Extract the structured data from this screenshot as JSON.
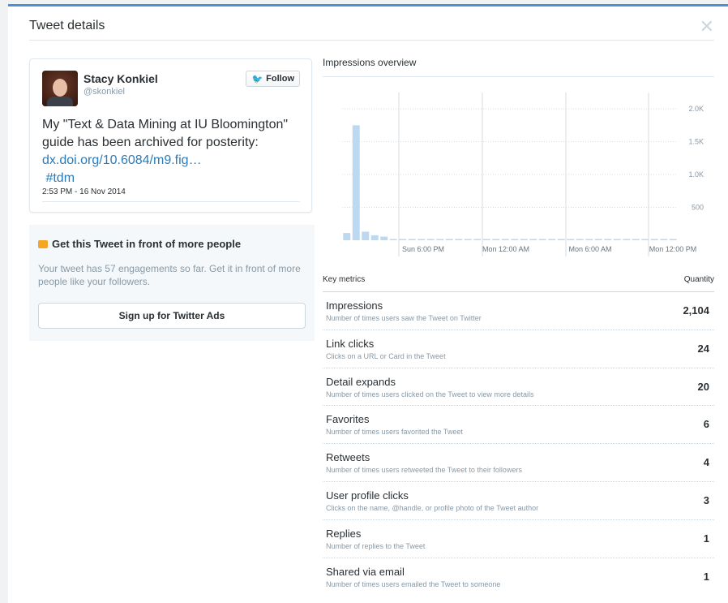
{
  "modal": {
    "title": "Tweet details",
    "close_glyph": "✕"
  },
  "tweet": {
    "author_name": "Stacy Konkiel",
    "author_handle": "@skonkiel",
    "follow_label": "Follow",
    "text_plain": "My \"Text & Data Mining at IU Bloomington\" guide has been archived for posterity: ",
    "link_text": "dx.doi.org/10.6084/m9.fig…",
    "hashtag": "#tdm",
    "timestamp": "2:53 PM - 16 Nov 2014"
  },
  "promo": {
    "title": "Get this Tweet in front of more people",
    "text": "Your tweet has 57 engagements so far. Get it in front of more people like your followers.",
    "button_label": "Sign up for Twitter Ads"
  },
  "impressions": {
    "title": "Impressions overview"
  },
  "chart_data": {
    "type": "bar",
    "y_ticks": [
      "500",
      "1.0K",
      "1.5K",
      "2.0K"
    ],
    "y_tick_values": [
      500,
      1000,
      1500,
      2000
    ],
    "ylim": [
      0,
      2100
    ],
    "x_labels": [
      "Sun 6:00 PM",
      "Mon 12:00 AM",
      "Mon 6:00 AM",
      "Mon 12:00 PM"
    ],
    "values": [
      110,
      1750,
      130,
      75,
      55,
      15,
      8,
      6,
      5,
      4,
      4,
      3,
      3,
      2,
      2,
      2,
      2,
      2,
      2,
      2,
      2,
      2,
      2,
      2,
      2,
      2,
      2,
      2,
      2,
      2,
      2,
      2,
      2,
      2,
      2,
      2
    ],
    "bar_color": "#bdd9f1"
  },
  "metrics": {
    "header_label": "Key metrics",
    "header_value": "Quantity",
    "rows": [
      {
        "label": "Impressions",
        "desc": "Number of times users saw the Tweet on Twitter",
        "value": "2,104"
      },
      {
        "label": "Link clicks",
        "desc": "Clicks on a URL or Card in the Tweet",
        "value": "24"
      },
      {
        "label": "Detail expands",
        "desc": "Number of times users clicked on the Tweet to view more details",
        "value": "20"
      },
      {
        "label": "Favorites",
        "desc": "Number of times users favorited the Tweet",
        "value": "6"
      },
      {
        "label": "Retweets",
        "desc": "Number of times users retweeted the Tweet to their followers",
        "value": "4"
      },
      {
        "label": "User profile clicks",
        "desc": "Clicks on the name, @handle, or profile photo of the Tweet author",
        "value": "3"
      },
      {
        "label": "Replies",
        "desc": "Number of replies to the Tweet",
        "value": "1"
      },
      {
        "label": "Shared via email",
        "desc": "Number of times users emailed the Tweet to someone",
        "value": "1"
      }
    ]
  }
}
